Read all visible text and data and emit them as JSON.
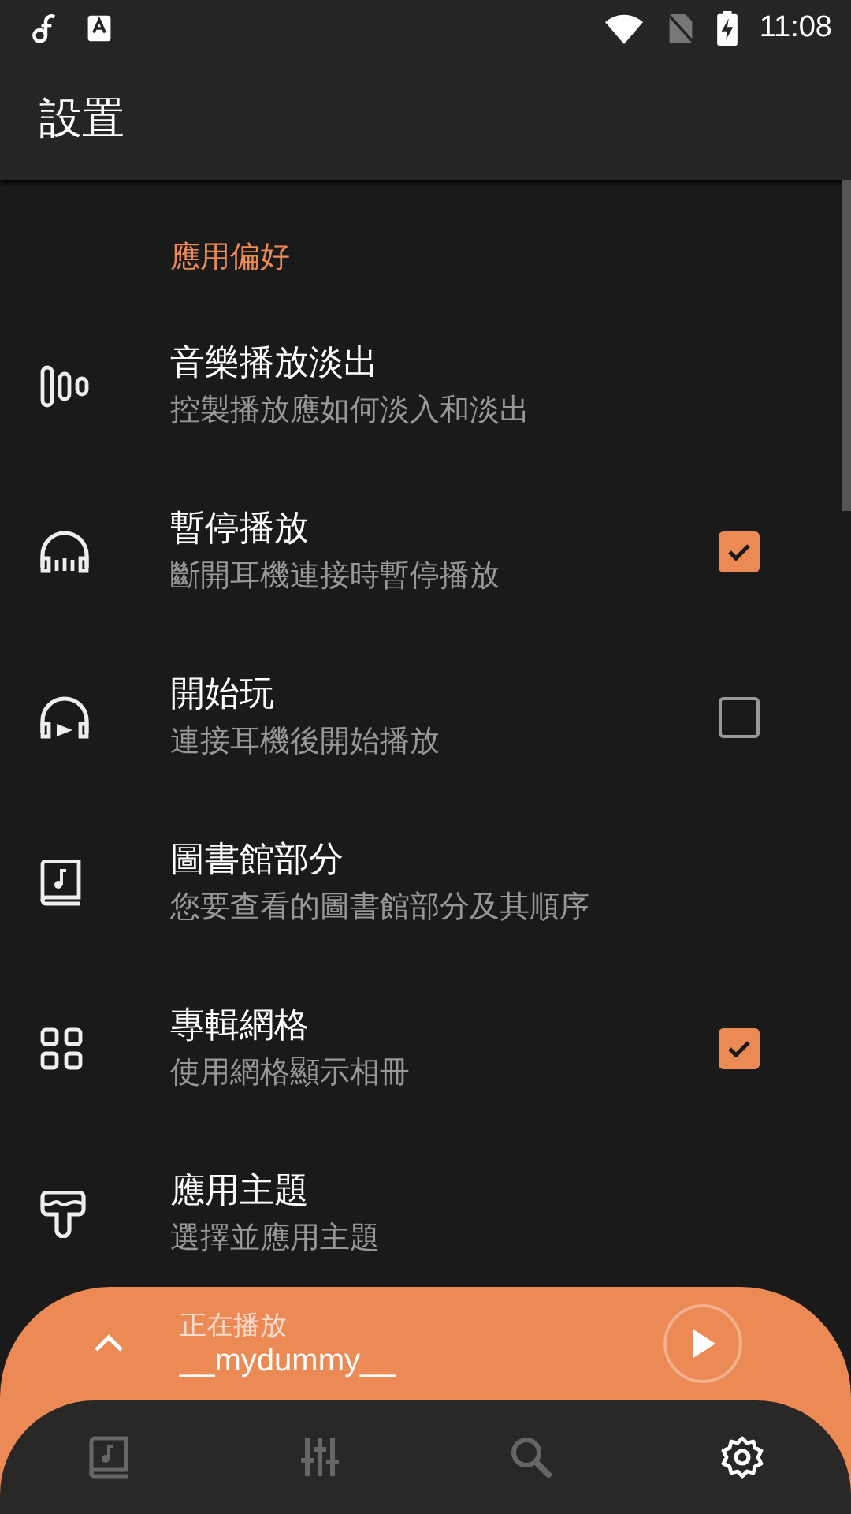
{
  "status_bar": {
    "time": "11:08"
  },
  "app_bar": {
    "title": "設置"
  },
  "section": {
    "title": "應用偏好"
  },
  "items": [
    {
      "kind": "plain",
      "title": "音樂播放淡出",
      "subtitle": "控製播放應如何淡入和淡出"
    },
    {
      "kind": "checkbox",
      "title": "暫停播放",
      "subtitle": "斷開耳機連接時暫停播放",
      "checked": true
    },
    {
      "kind": "checkbox",
      "title": "開始玩",
      "subtitle": "連接耳機後開始播放",
      "checked": false
    },
    {
      "kind": "plain",
      "title": "圖書館部分",
      "subtitle": "您要查看的圖書館部分及其順序"
    },
    {
      "kind": "checkbox",
      "title": "專輯網格",
      "subtitle": "使用網格顯示相冊",
      "checked": true
    },
    {
      "kind": "plain",
      "title": "應用主題",
      "subtitle": "選擇並應用主題"
    }
  ],
  "player": {
    "label": "正在播放",
    "track": "__mydummy__"
  },
  "nav": [
    {
      "selected": false
    },
    {
      "selected": false
    },
    {
      "selected": false
    },
    {
      "selected": true
    }
  ]
}
